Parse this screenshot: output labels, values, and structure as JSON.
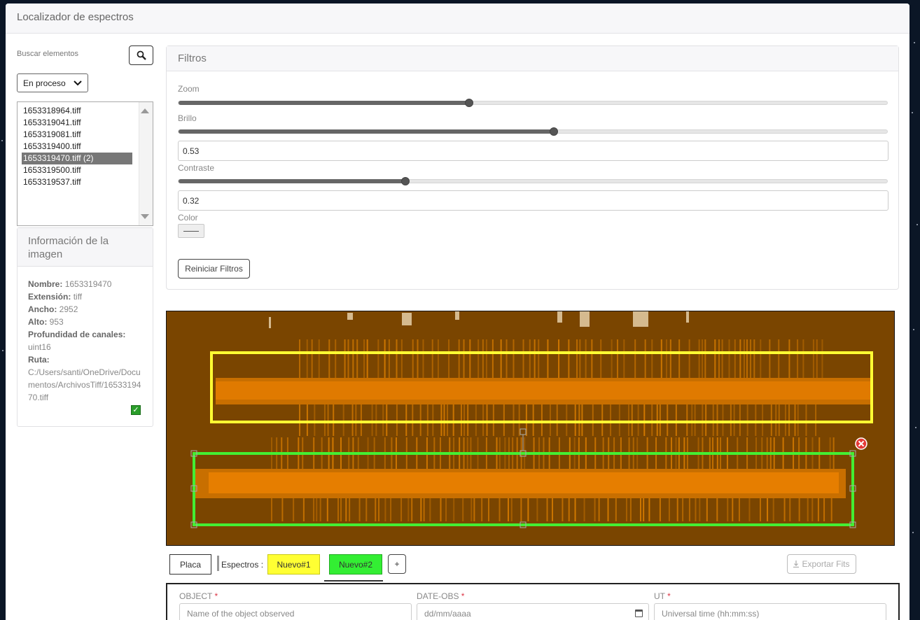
{
  "app": {
    "title": "Localizador de espectros"
  },
  "search": {
    "label": "Buscar elementos"
  },
  "status_filter": {
    "value": "En proceso"
  },
  "files": [
    {
      "name": "1653318964.tiff",
      "selected": false
    },
    {
      "name": "1653319041.tiff",
      "selected": false
    },
    {
      "name": "1653319081.tiff",
      "selected": false
    },
    {
      "name": "1653319400.tiff",
      "selected": false
    },
    {
      "name": "1653319470.tiff (2)",
      "selected": true
    },
    {
      "name": "1653319500.tiff",
      "selected": false
    },
    {
      "name": "1653319537.tiff",
      "selected": false
    }
  ],
  "info": {
    "title": "Información de la imagen",
    "name_label": "Nombre:",
    "name": "1653319470",
    "ext_label": "Extensión:",
    "ext": "tiff",
    "width_label": "Ancho:",
    "width": "2952",
    "height_label": "Alto:",
    "height": "953",
    "depth_label": "Profundidad de canales:",
    "depth": "uint16",
    "path_label": "Ruta:",
    "path": "C:/Users/santi/OneDrive/Documentos/ArchivosTiff/1653319470.tiff"
  },
  "filters": {
    "title": "Filtros",
    "zoom": {
      "label": "Zoom",
      "level": 0.41
    },
    "brightness": {
      "label": "Brillo",
      "level": 0.53,
      "value": "0.53"
    },
    "contrast": {
      "label": "Contraste",
      "level": 0.32,
      "value": "0.32"
    },
    "color_label": "Color",
    "reset_label": "Reiniciar Filtros"
  },
  "tabs": {
    "plate": "Placa",
    "spectra_label": "Espectros :",
    "spectra": [
      {
        "label": "Nuevo#1",
        "color": "#ffff33"
      },
      {
        "label": "Nuevo#2",
        "color": "#33ee33"
      }
    ],
    "add": "+",
    "export": "Exportar Fits"
  },
  "form": {
    "object": {
      "label": "OBJECT",
      "placeholder": "Name of the object observed"
    },
    "date_obs": {
      "label": "DATE-OBS",
      "placeholder": "dd/mm/aaaa"
    },
    "ut": {
      "label": "UT",
      "placeholder": "Universal time (hh:mm:ss)"
    }
  },
  "colors": {
    "plate_bg": "#7a4500",
    "spectrum": "#ff8c00",
    "selected_item": "#777777",
    "required": "#dc3545"
  }
}
